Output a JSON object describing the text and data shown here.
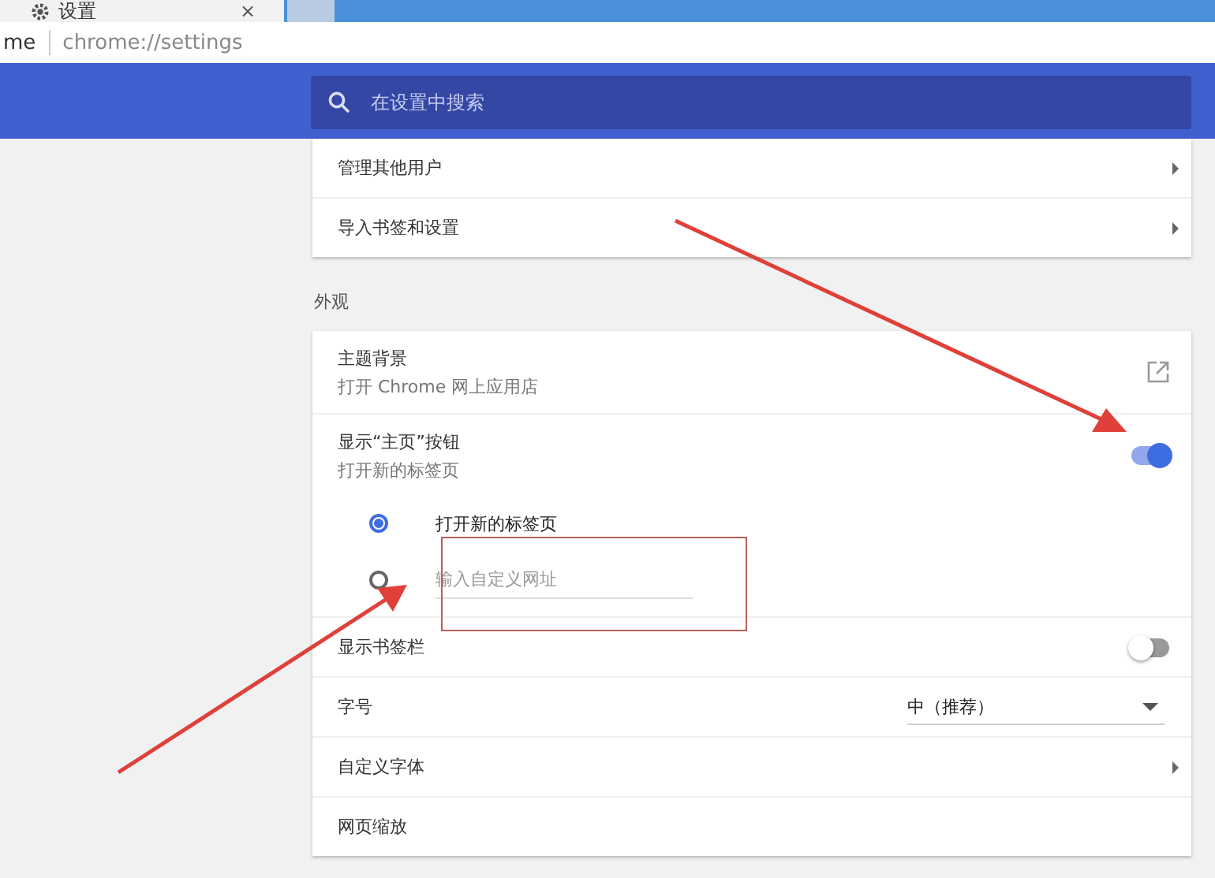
{
  "browser": {
    "tab": {
      "title": "设置",
      "close": "×"
    },
    "address": {
      "prefix": "me",
      "url": "chrome://settings"
    }
  },
  "search": {
    "placeholder": "在设置中搜索"
  },
  "sections": [
    {
      "rows": [
        {
          "kind": "link",
          "label": "管理其他用户"
        },
        {
          "kind": "link",
          "label": "导入书签和设置"
        }
      ]
    },
    {
      "title": "外观",
      "rows": [
        {
          "kind": "external",
          "label": "主题背景",
          "sublabel": "打开 Chrome 网上应用店"
        },
        {
          "kind": "toggle",
          "label": "显示“主页”按钮",
          "sublabel": "打开新的标签页",
          "on": true,
          "options": [
            {
              "kind": "text",
              "label": "打开新的标签页",
              "selected": true
            },
            {
              "kind": "input",
              "placeholder": "输入自定义网址",
              "selected": false
            }
          ]
        },
        {
          "kind": "toggle",
          "label": "显示书签栏",
          "on": false
        },
        {
          "kind": "select",
          "label": "字号",
          "value": "中（推荐）"
        },
        {
          "kind": "link",
          "label": "自定义字体"
        },
        {
          "kind": "plain",
          "label": "网页缩放"
        }
      ]
    }
  ]
}
